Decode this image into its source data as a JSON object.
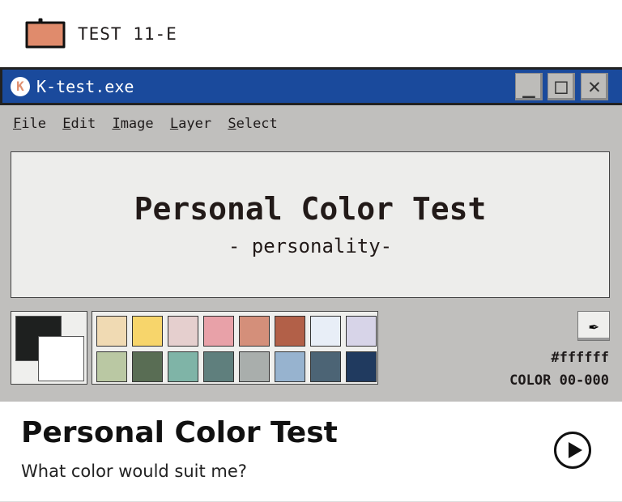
{
  "header": {
    "title": "TEST 11-E",
    "folder_color": "#e08b6c"
  },
  "window": {
    "title": "K-test.exe",
    "logo_letter": "K",
    "buttons": {
      "minimize": "_",
      "maximize": "□",
      "close": "✕"
    }
  },
  "menu": [
    {
      "key": "F",
      "rest": "ile"
    },
    {
      "key": "E",
      "rest": "dit"
    },
    {
      "key": "I",
      "rest": "mage"
    },
    {
      "key": "L",
      "rest": "ayer"
    },
    {
      "key": "S",
      "rest": "elect"
    }
  ],
  "canvas": {
    "title": "Personal Color Test",
    "subtitle": "- personality-"
  },
  "colors": {
    "foreground": "#1e201f",
    "background": "#ffffff"
  },
  "palette": [
    "#f0dab3",
    "#f7d56b",
    "#e5cfce",
    "#e8a1a8",
    "#d48f7a",
    "#b26048",
    "#e8eef7",
    "#d7d4e8",
    "#bac8a3",
    "#596d54",
    "#7fb4a7",
    "#5f7f7d",
    "#a9aeac",
    "#97b3cf",
    "#4c6475",
    "#203a5f"
  ],
  "status": {
    "hex": "#ffffff",
    "code": "COLOR 00-000"
  },
  "card": {
    "title": "Personal Color Test",
    "subtitle": "What color would suit me?"
  }
}
